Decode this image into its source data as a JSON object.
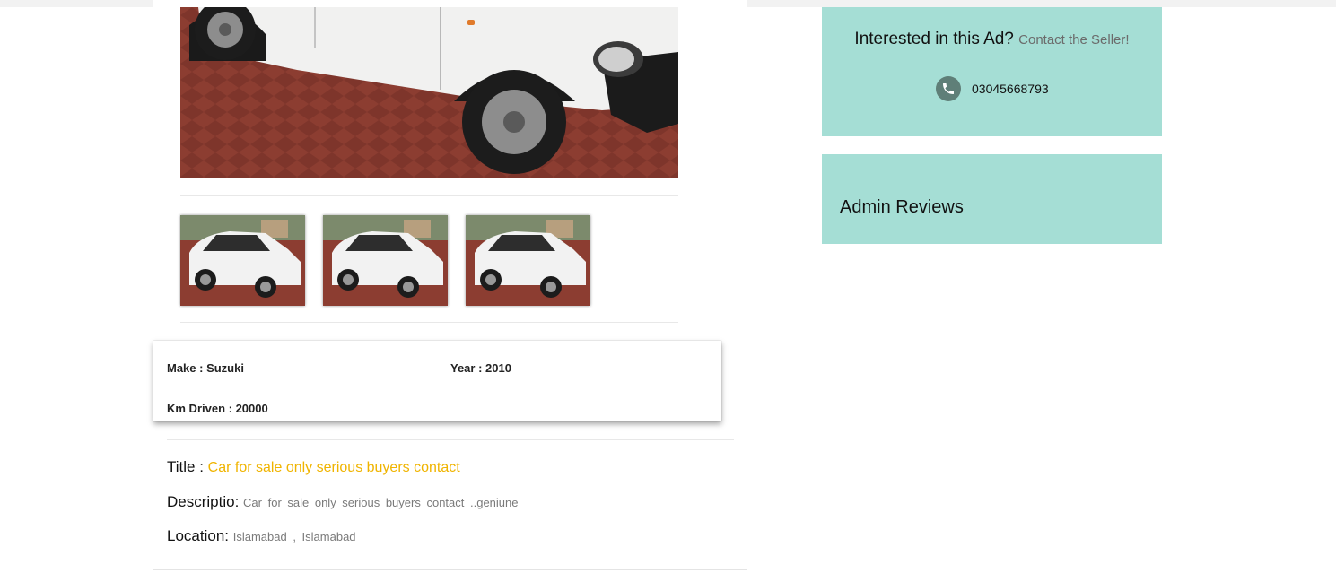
{
  "specs": {
    "make": "Make : Suzuki",
    "year": "Year : 2010",
    "km": "Km Driven : 20000"
  },
  "details": {
    "title_label": "Title :",
    "title_value": "Car for sale only serious buyers contact",
    "description_label": "Descriptio:",
    "description_value": "Car for sale only serious buyers contact ..geniune",
    "location_label": "Location:",
    "location_value": "Islamabad , Islamabad"
  },
  "contact": {
    "heading": "Interested in this Ad?",
    "subheading": "Contact the Seller!",
    "phone": "03045668793"
  },
  "reviews": {
    "title": "Admin Reviews"
  },
  "colors": {
    "sidebar_bg": "#a5ded5",
    "title_accent": "#f0b400"
  }
}
